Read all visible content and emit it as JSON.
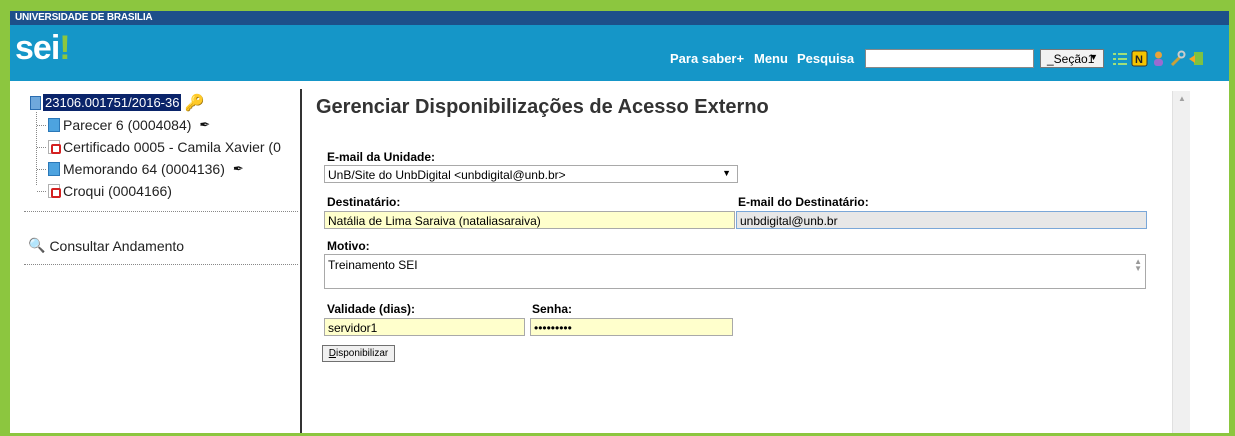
{
  "header": {
    "university": "UNIVERSIDADE DE BRASILIA",
    "logo": "sei",
    "nav": [
      "Para saber+",
      "Menu",
      "Pesquisa"
    ],
    "search_placeholder": "",
    "section_select": "_Seção1",
    "icons": [
      "list-icon",
      "note-icon",
      "user-icon",
      "tools-icon",
      "exit-icon"
    ]
  },
  "tree": {
    "root": "23106.001751/2016-36",
    "nodes": [
      {
        "label": "Parecer 6 (0004084)",
        "icon": "document-icon",
        "signed": true
      },
      {
        "label": "Certificado 0005 - Camila Xavier (0",
        "icon": "pdf-icon",
        "signed": false
      },
      {
        "label": "Memorando 64 (0004136)",
        "icon": "document-icon",
        "signed": true
      },
      {
        "label": "Croqui (0004166)",
        "icon": "pdf-icon",
        "signed": false
      }
    ],
    "consult": "Consultar Andamento"
  },
  "form": {
    "title": "Gerenciar Disponibilizações de Acesso Externo",
    "email_unidade_label": "E-mail da Unidade:",
    "email_unidade_value": "UnB/Site do UnbDigital <unbdigital@unb.br>",
    "destinatario_label": "Destinatário:",
    "destinatario_value": "Natália de Lima Saraiva (nataliasaraiva)",
    "email_dest_label": "E-mail do Destinatário:",
    "email_dest_value": "unbdigital@unb.br",
    "motivo_label": "Motivo:",
    "motivo_value": "Treinamento SEI",
    "validade_label": "Validade (dias):",
    "validade_value": "servidor1",
    "senha_label": "Senha:",
    "senha_value": "•••••••••",
    "submit_first": "D",
    "submit_rest": "isponibilizar"
  },
  "colors": {
    "brand_blue": "#1596c8",
    "top_navy": "#1d4f8a",
    "frame_green": "#8cc63f"
  }
}
